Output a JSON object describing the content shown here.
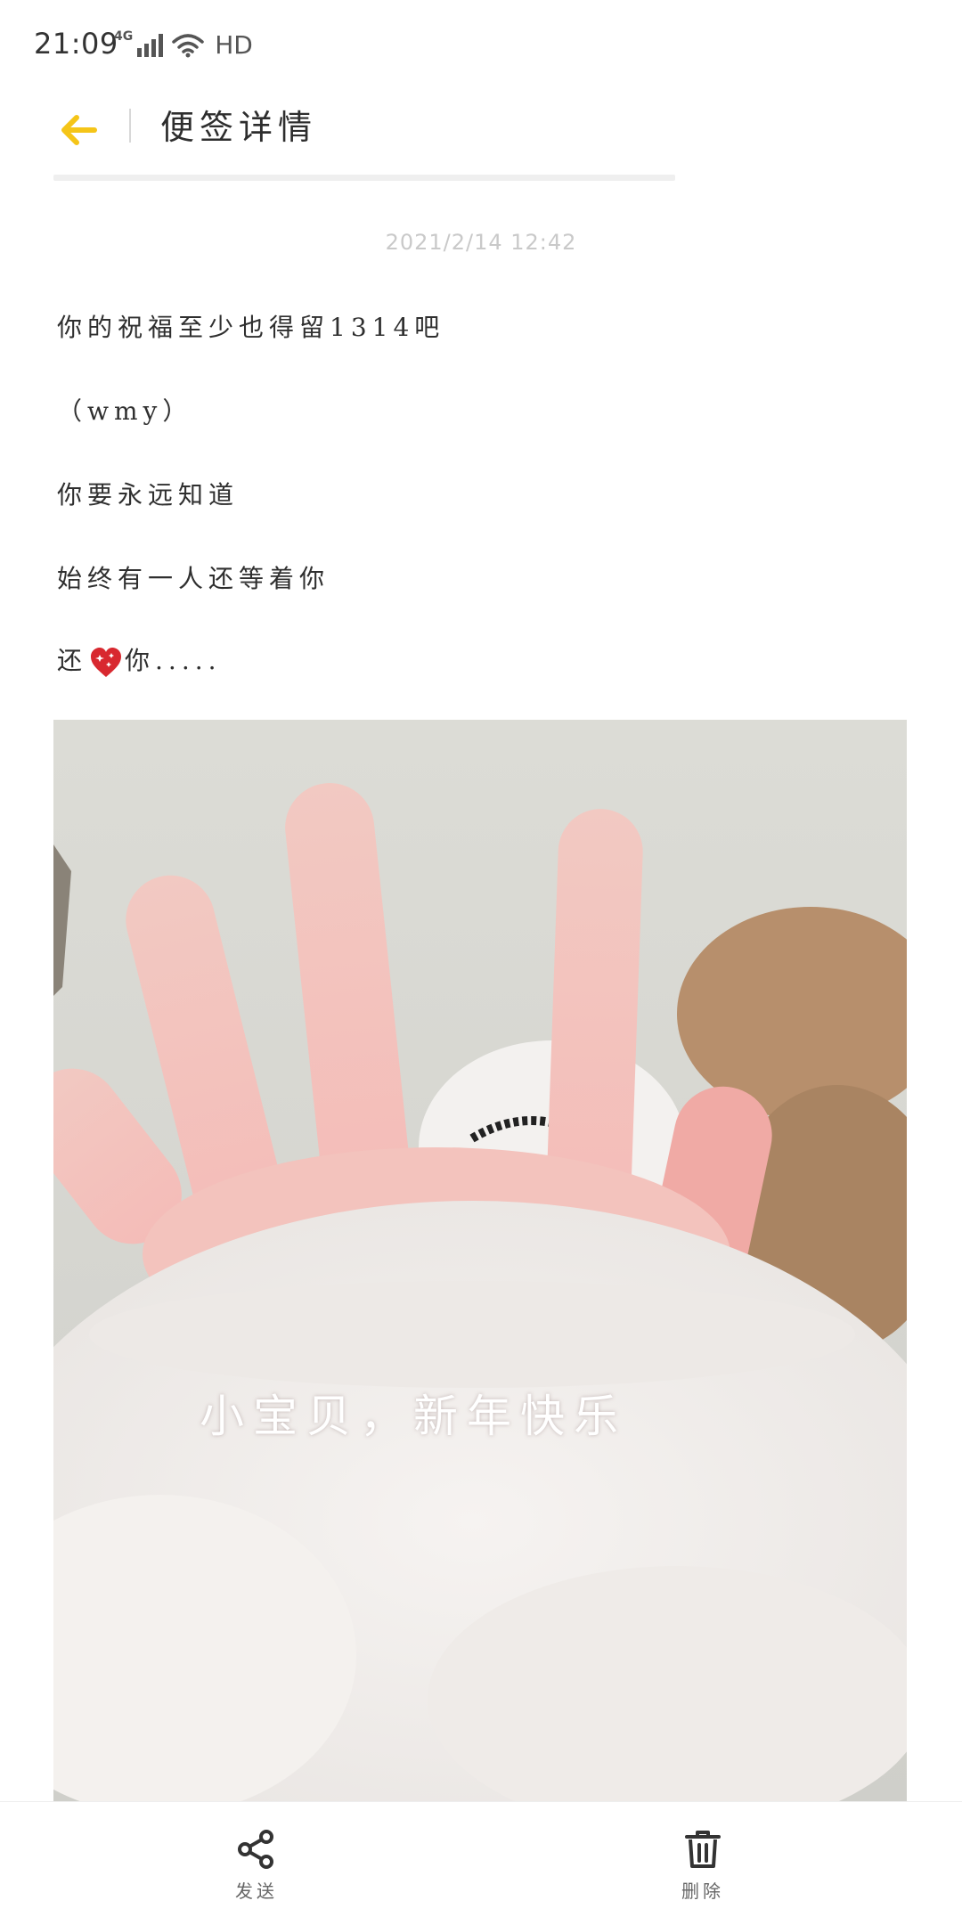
{
  "status_bar": {
    "time": "21:09",
    "network": "4G",
    "quality": "HD"
  },
  "header": {
    "title": "便签详情",
    "back_icon": "arrow-left-icon",
    "accent_color": "#F5C518"
  },
  "note": {
    "date": "2021/2/14 12:42",
    "lines": [
      "你的祝福至少也得留1314吧",
      "（wmy）",
      "你要永远知道",
      "始终有一人还等着你"
    ],
    "last_line": {
      "before": "还",
      "icon": "sparkling-heart-icon",
      "after": "你....."
    },
    "photo_caption": "小宝贝，新年快乐"
  },
  "toolbar": {
    "send_label": "发送",
    "send_icon": "share-icon",
    "delete_label": "删除",
    "delete_icon": "trash-icon"
  }
}
